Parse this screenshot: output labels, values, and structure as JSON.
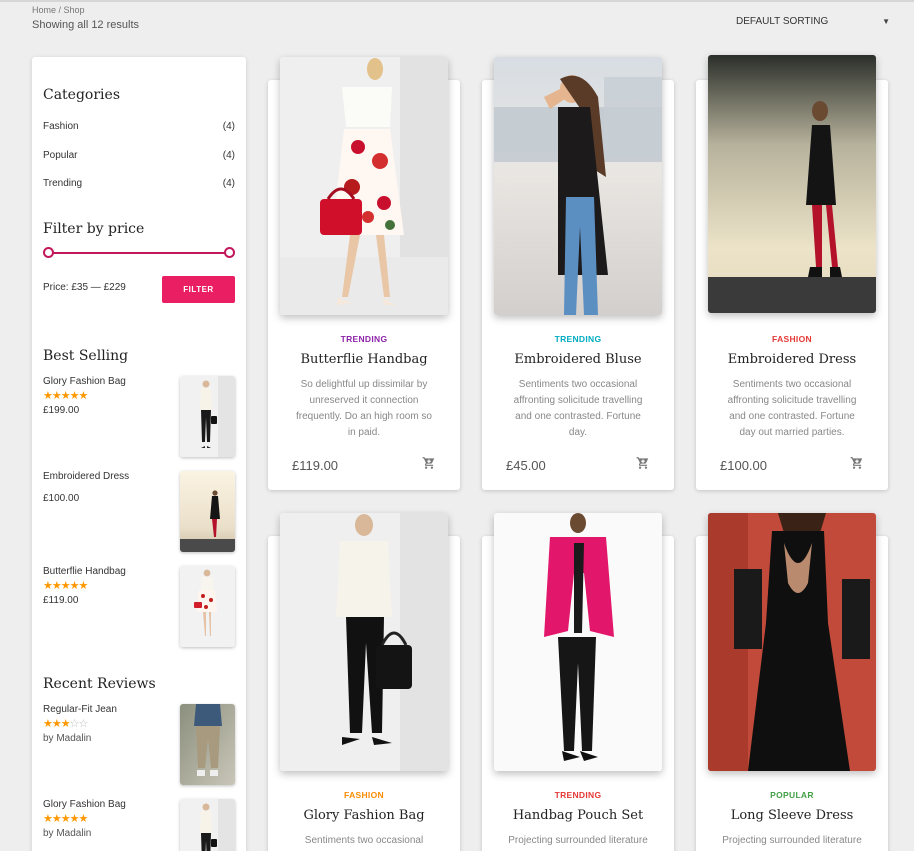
{
  "breadcrumb": "Home / Shop",
  "result_count": "Showing all 12 results",
  "sorting": {
    "selected": "DEFAULT SORTING",
    "icon": "caret-down-icon"
  },
  "sidebar": {
    "categories_title": "Categories",
    "categories": [
      {
        "name": "Fashion",
        "count": "(4)"
      },
      {
        "name": "Popular",
        "count": "(4)"
      },
      {
        "name": "Trending",
        "count": "(4)"
      }
    ],
    "filter_title": "Filter by price",
    "price_label": "Price: £35 — £229",
    "filter_button": "FILTER",
    "best_selling_title": "Best Selling",
    "best_selling": [
      {
        "name": "Glory Fashion Bag",
        "price": "£199.00",
        "rating": 5
      },
      {
        "name": "Embroidered Dress",
        "price": "£100.00",
        "rating": 0
      },
      {
        "name": "Butterflie Handbag",
        "price": "£119.00",
        "rating": 5
      }
    ],
    "recent_reviews_title": "Recent Reviews",
    "recent_reviews": [
      {
        "name": "Regular-Fit Jean",
        "rating": 3,
        "author": "by Madalin"
      },
      {
        "name": "Glory Fashion Bag",
        "rating": 5,
        "author": "by Madalin"
      }
    ]
  },
  "colors": {
    "accent": "#e91e63",
    "slider": "#c2185b",
    "star": "#ff9800",
    "trending_purple": "#8e24aa",
    "trending_teal": "#00acc1",
    "fashion_red": "#e53935",
    "fashion_orange": "#fb8c00",
    "popular_green": "#43a047"
  },
  "products": [
    {
      "category": "TRENDING",
      "cat_color": "#8e24aa",
      "title": "Butterflie Handbag",
      "desc": "So delightful up dissimilar by unreserved it connection frequently. Do an high room so in paid.",
      "price": "£119.00"
    },
    {
      "category": "TRENDING",
      "cat_color": "#00acc1",
      "title": "Embroidered Bluse",
      "desc": "Sentiments two occasional affronting solicitude travelling and one contrasted. Fortune day.",
      "price": "£45.00"
    },
    {
      "category": "FASHION",
      "cat_color": "#e53935",
      "title": "Embroidered Dress",
      "desc": "Sentiments two occasional affronting solicitude travelling and one contrasted. Fortune day out married parties.",
      "price": "£100.00"
    },
    {
      "category": "FASHION",
      "cat_color": "#fb8c00",
      "title": "Glory Fashion Bag",
      "desc": "Sentiments two occasional",
      "price": ""
    },
    {
      "category": "TRENDING",
      "cat_color": "#e53935",
      "title": "Handbag Pouch Set",
      "desc": "Projecting surrounded literature",
      "price": ""
    },
    {
      "category": "POPULAR",
      "cat_color": "#43a047",
      "title": "Long Sleeve Dress",
      "desc": "Projecting surrounded literature",
      "price": ""
    }
  ]
}
